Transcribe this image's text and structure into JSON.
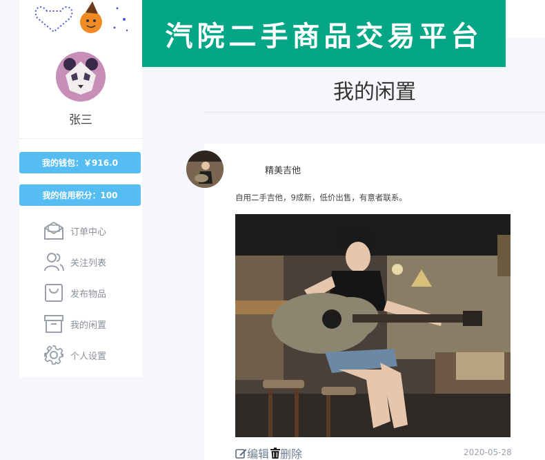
{
  "header": {
    "title": "汽院二手商品交易平台"
  },
  "profile": {
    "username": "张三",
    "wallet_label": "我的钱包：￥916.0",
    "credit_label": "我的信用积分：100"
  },
  "nav": {
    "items": [
      {
        "label": "订单中心",
        "icon": "envelope-icon"
      },
      {
        "label": "关注列表",
        "icon": "people-icon"
      },
      {
        "label": "发布物品",
        "icon": "bag-icon"
      },
      {
        "label": "我的闲置",
        "icon": "archive-icon"
      },
      {
        "label": "个人设置",
        "icon": "gear-icon"
      }
    ]
  },
  "main": {
    "page_title": "我的闲置",
    "item": {
      "name": "精美吉他",
      "description": "自用二手吉他，9成新，低价出售，有意者联系。",
      "edit_label": "编辑",
      "delete_label": "删除",
      "date": "2020-05-28"
    }
  },
  "colors": {
    "banner": "#04a685",
    "pill": "#56bdf2",
    "page_bg": "#f5f7fa"
  }
}
